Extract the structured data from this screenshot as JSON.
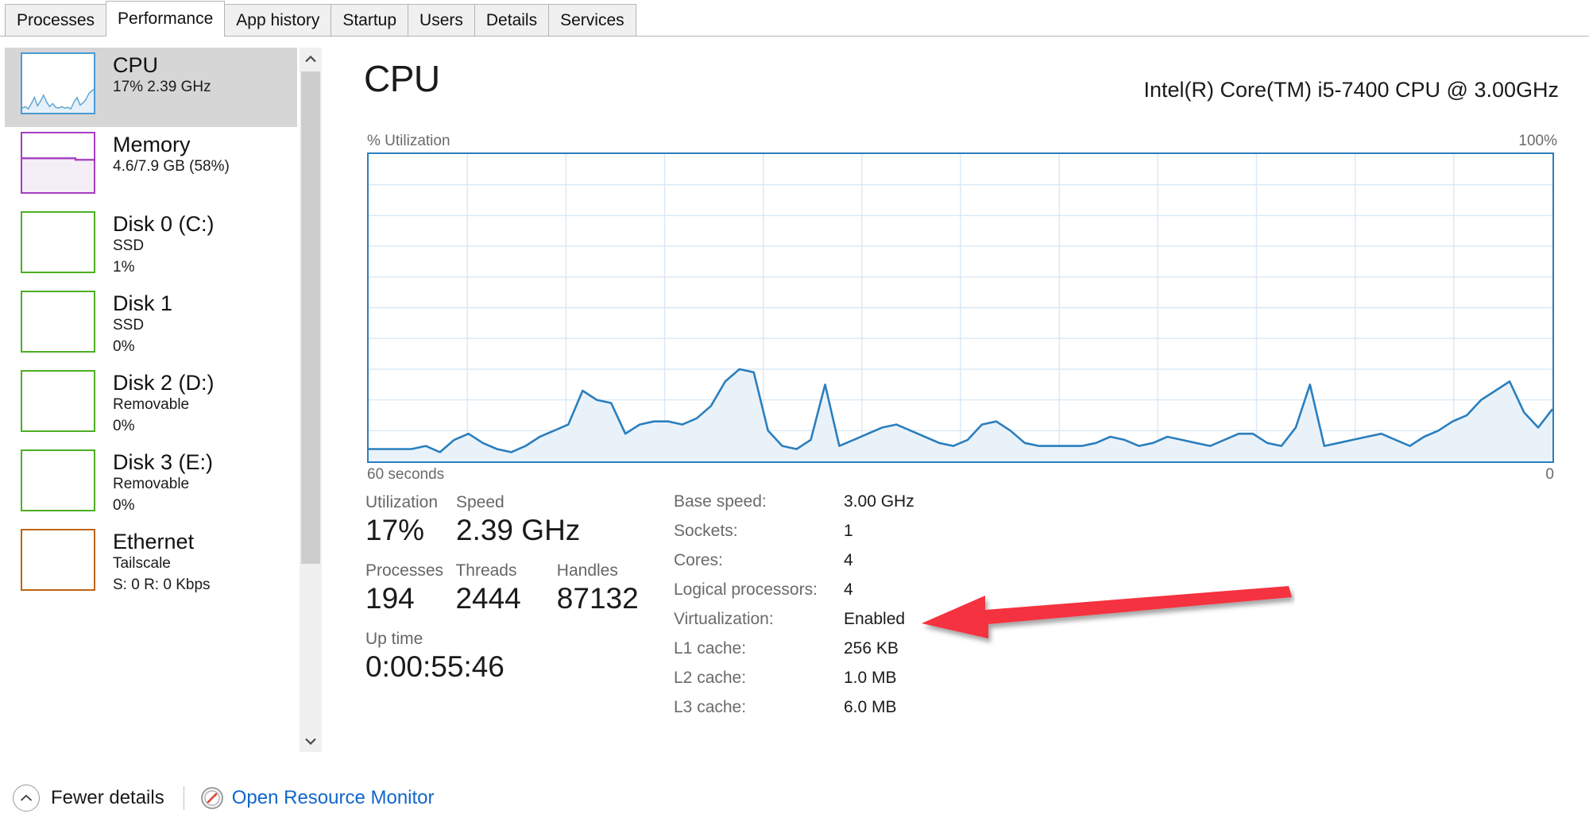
{
  "window": {
    "tabs": [
      {
        "label": "Processes",
        "active": false
      },
      {
        "label": "Performance",
        "active": true
      },
      {
        "label": "App history",
        "active": false
      },
      {
        "label": "Startup",
        "active": false
      },
      {
        "label": "Users",
        "active": false
      },
      {
        "label": "Details",
        "active": false
      },
      {
        "label": "Services",
        "active": false
      }
    ]
  },
  "sidebar": {
    "items": [
      {
        "title": "CPU",
        "line1": "17% 2.39 GHz",
        "line2": "",
        "selected": true,
        "accent": "#4a9bd4",
        "kind": "cpu"
      },
      {
        "title": "Memory",
        "line1": "4.6/7.9 GB (58%)",
        "line2": "",
        "selected": false,
        "accent": "#a33ec2",
        "kind": "memory"
      },
      {
        "title": "Disk 0 (C:)",
        "line1": "SSD",
        "line2": "1%",
        "selected": false,
        "accent": "#4caf22",
        "kind": "disk"
      },
      {
        "title": "Disk 1",
        "line1": "SSD",
        "line2": "0%",
        "selected": false,
        "accent": "#4caf22",
        "kind": "disk"
      },
      {
        "title": "Disk 2 (D:)",
        "line1": "Removable",
        "line2": "0%",
        "selected": false,
        "accent": "#4caf22",
        "kind": "disk"
      },
      {
        "title": "Disk 3 (E:)",
        "line1": "Removable",
        "line2": "0%",
        "selected": false,
        "accent": "#4caf22",
        "kind": "disk"
      },
      {
        "title": "Ethernet",
        "line1": "Tailscale",
        "line2": "S: 0 R: 0 Kbps",
        "selected": false,
        "accent": "#bf6414",
        "kind": "network"
      }
    ],
    "scroll_up_icon": "chevron-up-icon",
    "scroll_down_icon": "chevron-down-icon"
  },
  "main": {
    "title": "CPU",
    "model": "Intel(R) Core(TM) i5-7400 CPU @ 3.00GHz",
    "axis": {
      "top_left": "% Utilization",
      "top_right": "100%",
      "bottom_left": "60 seconds",
      "bottom_right": "0"
    },
    "stats": {
      "utilization_label": "Utilization",
      "utilization_value": "17%",
      "speed_label": "Speed",
      "speed_value": "2.39 GHz",
      "processes_label": "Processes",
      "processes_value": "194",
      "threads_label": "Threads",
      "threads_value": "2444",
      "handles_label": "Handles",
      "handles_value": "87132",
      "uptime_label": "Up time",
      "uptime_value": "0:00:55:46"
    },
    "specs": [
      {
        "key": "Base speed:",
        "value": "3.00 GHz"
      },
      {
        "key": "Sockets:",
        "value": "1"
      },
      {
        "key": "Cores:",
        "value": "4"
      },
      {
        "key": "Logical processors:",
        "value": "4"
      },
      {
        "key": "Virtualization:",
        "value": "Enabled"
      },
      {
        "key": "L1 cache:",
        "value": "256 KB"
      },
      {
        "key": "L2 cache:",
        "value": "1.0 MB"
      },
      {
        "key": "L3 cache:",
        "value": "6.0 MB"
      }
    ],
    "annotation": {
      "name": "red-arrow-pointing-to-virtualization",
      "color": "#f5333f",
      "points_to": "Enabled"
    }
  },
  "footer": {
    "fewer_details_label": "Fewer details",
    "fewer_details_icon": "chevron-up-circle-icon",
    "resource_monitor_label": "Open Resource Monitor",
    "resource_monitor_icon": "resource-monitor-icon",
    "link_color": "#1166cc"
  },
  "chart_data": {
    "type": "area",
    "title": "CPU % Utilization over 60 seconds",
    "xlabel": "60 seconds",
    "ylabel": "% Utilization",
    "ylim": [
      0,
      100
    ],
    "xlim": [
      60,
      0
    ],
    "grid": true,
    "grid_rows": 10,
    "grid_cols": 12,
    "line_color": "#2a7fbe",
    "fill_color": "#eaf2f9",
    "current_value": 17,
    "values": [
      4,
      4,
      4,
      4,
      5,
      3,
      7,
      9,
      6,
      4,
      3,
      5,
      8,
      10,
      12,
      23,
      20,
      19,
      9,
      12,
      13,
      13,
      12,
      14,
      18,
      26,
      30,
      29,
      10,
      5,
      4,
      7,
      25,
      5,
      7,
      9,
      11,
      12,
      10,
      8,
      6,
      5,
      7,
      12,
      13,
      10,
      6,
      5,
      5,
      5,
      5,
      6,
      8,
      7,
      5,
      6,
      8,
      7,
      6,
      5,
      7,
      9,
      9,
      6,
      5,
      11,
      25,
      5,
      6,
      7,
      8,
      9,
      7,
      5,
      8,
      10,
      13,
      15,
      20,
      23,
      26,
      16,
      11,
      17
    ]
  }
}
